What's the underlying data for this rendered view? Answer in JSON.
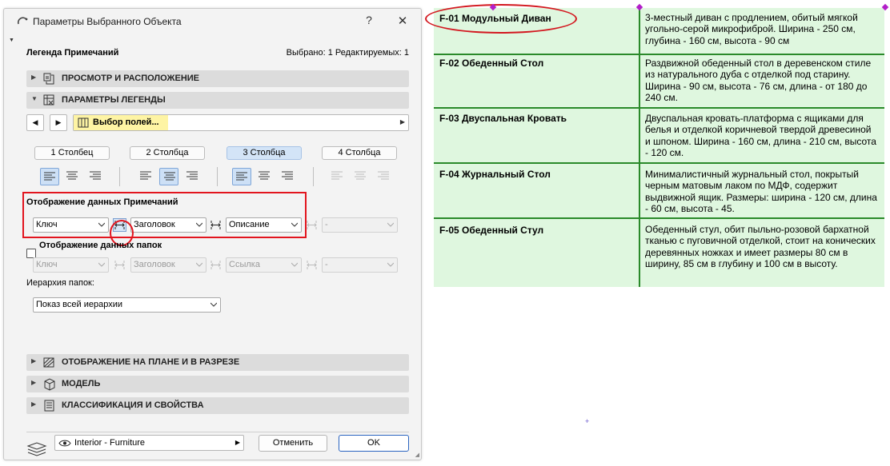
{
  "dialog": {
    "title": "Параметры Выбранного Объекта",
    "help_label": "?",
    "close_label": "✕",
    "header_left": "Легенда Примечаний",
    "header_right": "Выбрано: 1 Редактируемых: 1"
  },
  "sections": {
    "view": "ПРОСМОТР И РАСПОЛОЖЕНИЕ",
    "legend": "ПАРАМЕТРЫ ЛЕГЕНДЫ",
    "plan": "ОТОБРАЖЕНИЕ НА ПЛАНЕ И В РАЗРЕЗЕ",
    "model": "МОДЕЛЬ",
    "classification": "КЛАССИФИКАЦИЯ И СВОЙСТВА"
  },
  "fields_bar": {
    "prev_label": "◀",
    "next_label": "▶",
    "label": "Выбор полей..."
  },
  "columns": {
    "c1": "1 Столбец",
    "c2": "2 Столбца",
    "c3": "3 Столбца",
    "c4": "4 Столбца",
    "active": "3 Столбца"
  },
  "notes_display": {
    "label": "Отображение данных Примечаний",
    "key": "Ключ",
    "heading": "Заголовок",
    "description": "Описание",
    "fourth": "-"
  },
  "folders_display": {
    "label": "Отображение данных папок",
    "checked": false,
    "key": "Ключ",
    "heading": "Заголовок",
    "link": "Ссылка",
    "fourth": "-"
  },
  "hierarchy": {
    "label": "Иерархия папок:",
    "value": "Показ всей иерархии"
  },
  "footer": {
    "layer": "Interior - Furniture",
    "cancel": "Отменить",
    "ok": "OK"
  },
  "legend_table": {
    "rows": [
      {
        "key": "F-01 Модульный Диван",
        "desc": "3-местный диван с продлением, обитый мягкой угольно-серой микрофиброй. Ширина - 250 см, глубина - 160 см, высота - 90 см"
      },
      {
        "key": "F-02 Обеденный Стол",
        "desc": "Раздвижной обеденный стол в деревенском стиле из натурального дуба с отделкой под старину. Ширина - 90 см, высота - 76 см, длина - от 180 до 240 см."
      },
      {
        "key": "F-03 Двуспальная Кровать",
        "desc": "Двуспальная кровать-платформа с ящиками для белья и отделкой коричневой твердой древесиной и шпоном. Ширина - 160 см, длина - 210 см, высота - 120 см."
      },
      {
        "key": "F-04 Журнальный Стол",
        "desc": "Минималистичный журнальный стол, покрытый черным матовым лаком по МДФ, содержит выдвижной ящик. Размеры: ширина - 120 см, длина - 60 см, высота - 45."
      },
      {
        "key": "F-05 Обеденный Стул",
        "desc": "Обеденный стул, обит пыльно-розовой бархатной тканью с пуговичной отделкой, стоит на конических деревянных ножках и имеет размеры 80 см в ширину, 85 см в глубину и 100 см в высоту."
      }
    ]
  },
  "colors": {
    "highlight_red": "#e2151e",
    "table_fill": "#dff7df",
    "table_grid": "#2a8a2a",
    "selected_blue": "#cde0f6",
    "field_yellow": "#fef4a4"
  }
}
